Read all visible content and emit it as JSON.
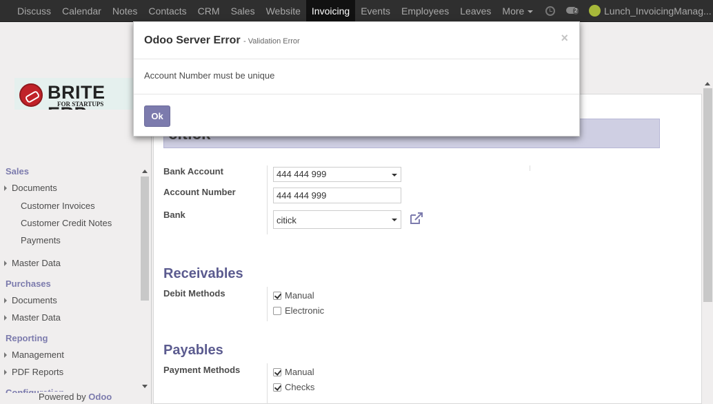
{
  "navbar": {
    "menu": [
      "Discuss",
      "Calendar",
      "Notes",
      "Contacts",
      "CRM",
      "Sales",
      "Website",
      "Invoicing",
      "Events",
      "Employees",
      "Leaves",
      "More"
    ],
    "active": "Invoicing",
    "chat_count": "2",
    "user": "Lunch_InvoicingManag..."
  },
  "logo": {
    "title": "BRITE ERP",
    "subtitle": "FOR STARTUPS"
  },
  "sidebar": {
    "sales": "Sales",
    "sales_documents": "Documents",
    "customer_invoices": "Customer Invoices",
    "customer_credit_notes": "Customer Credit Notes",
    "payments": "Payments",
    "sales_master_data": "Master Data",
    "purchases": "Purchases",
    "purchases_documents": "Documents",
    "purchases_master_data": "Master Data",
    "reporting": "Reporting",
    "management": "Management",
    "pdf_reports": "PDF Reports",
    "configuration": "Configuration",
    "powered_by": "Powered by",
    "odoo": "Odoo"
  },
  "form": {
    "name": "citick",
    "bank_account_label": "Bank Account",
    "bank_account_value": "444 444 999",
    "account_number_label": "Account Number",
    "account_number_value": "444 444 999",
    "bank_label": "Bank",
    "bank_value": "citick",
    "receivables_title": "Receivables",
    "debit_methods_label": "Debit Methods",
    "debit_manual": "Manual",
    "debit_electronic": "Electronic",
    "payables_title": "Payables",
    "payment_methods_label": "Payment Methods",
    "payment_manual": "Manual",
    "payment_checks": "Checks"
  },
  "dialog": {
    "title": "Odoo Server Error",
    "subtitle": "- Validation Error",
    "close": "×",
    "message": "Account Number must be unique",
    "ok": "Ok"
  },
  "colors": {
    "accent": "#7c7bad",
    "navbar": "#2f2f2f"
  }
}
